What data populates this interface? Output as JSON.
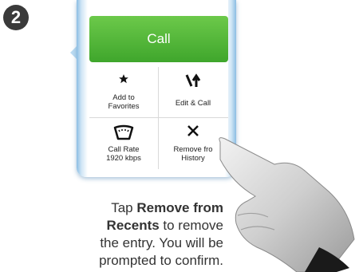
{
  "step": {
    "number": "2"
  },
  "call_menu": {
    "call_label": "Call",
    "add_favorites_line1": "Add to",
    "add_favorites_line2": "Favorites",
    "edit_call_label": "Edit & Call",
    "call_rate_line1": "Call Rate",
    "call_rate_line2": "1920 kbps",
    "remove_history_line1": "Remove fro",
    "remove_history_line2": "History"
  },
  "instruction": {
    "prefix": "Tap ",
    "bold1": "Remove from",
    "bold2": "Recents",
    "line2_suffix": " to remove",
    "line3": "the entry. You will be",
    "line4": "prompted to confirm."
  },
  "colors": {
    "call_green": "#4cb237",
    "frame_blue": "#8bbde3",
    "badge": "#3a3a3a"
  }
}
